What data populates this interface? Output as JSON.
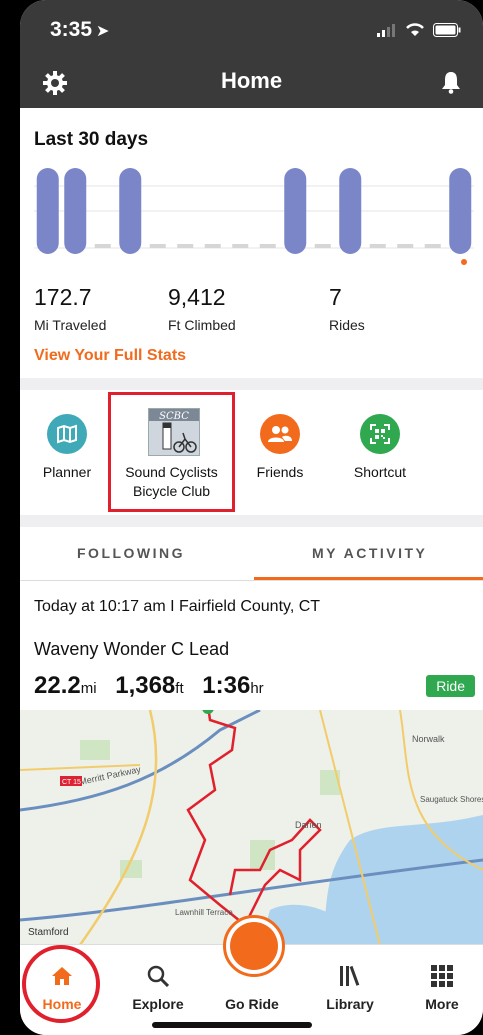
{
  "status": {
    "time": "3:35"
  },
  "nav": {
    "title": "Home"
  },
  "stats": {
    "title": "Last 30 days",
    "bars": [
      1,
      1,
      0,
      1,
      0,
      0,
      0,
      0,
      0,
      1,
      0,
      1,
      0,
      0,
      0,
      1
    ],
    "miles": "172.7",
    "miles_label": "Mi Traveled",
    "feet": "9,412",
    "feet_label": "Ft Climbed",
    "rides": "7",
    "rides_label": "Rides",
    "full_link": "View Your Full Stats"
  },
  "shortcuts": {
    "planner": "Planner",
    "club_line1": "Sound Cyclists",
    "club_line2": "Bicycle Club",
    "club_logo_text": "SCBC",
    "friends": "Friends",
    "shortcut": "Shortcut"
  },
  "tabs": {
    "following": "FOLLOWING",
    "my_activity": "MY ACTIVITY"
  },
  "activity": {
    "meta": "Today at 10:17 am  I  Fairfield County, CT",
    "title": "Waveny Wonder C Lead",
    "distance": "22.2",
    "distance_unit": "mi",
    "elevation": "1,368",
    "elevation_unit": "ft",
    "duration": "1:36",
    "duration_unit": "hr",
    "badge": "Ride"
  },
  "map_labels": {
    "merritt": "Merritt Parkway",
    "norwalk": "Norwalk",
    "darien": "Darien",
    "stamford": "Stamford",
    "saugatuck": "Saugatuck Shores",
    "ct15": "CT 15",
    "lawnhill": "Lawnhill Terrace"
  },
  "tabbar": {
    "home": "Home",
    "explore": "Explore",
    "goride": "Go Ride",
    "library": "Library",
    "more": "More"
  },
  "colors": {
    "accent": "#f26b1d",
    "bar": "#7b86c8",
    "highlight": "#e0202c",
    "ride": "#2fa84f"
  }
}
